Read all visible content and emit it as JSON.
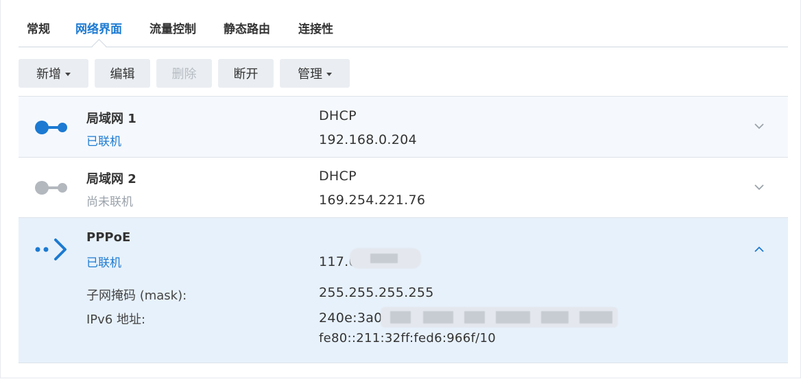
{
  "tabs": [
    {
      "label": "常规",
      "active": false
    },
    {
      "label": "网络界面",
      "active": true
    },
    {
      "label": "流量控制",
      "active": false
    },
    {
      "label": "静态路由",
      "active": false
    },
    {
      "label": "连接性",
      "active": false
    }
  ],
  "toolbar": {
    "add_label": "新增",
    "edit_label": "编辑",
    "delete_label": "删除",
    "disconnect_label": "断开",
    "manage_label": "管理"
  },
  "interfaces": [
    {
      "name": "局域网 1",
      "status": "已联机",
      "mode": "DHCP",
      "ip": "192.168.0.204",
      "icon": "ethernet-connected-icon",
      "expanded": false
    },
    {
      "name": "局域网 2",
      "status": "尚未联机",
      "mode": "DHCP",
      "ip": "169.254.221.76",
      "icon": "ethernet-disconnected-icon",
      "expanded": false
    },
    {
      "name": "PPPoE",
      "status": "已联机",
      "ip": "117.6",
      "icon": "pppoe-icon",
      "expanded": true,
      "details": {
        "mask_label": "子网掩码 (mask):",
        "mask_value": "255.255.255.255",
        "ipv6_label": "IPv6 地址:",
        "ipv6_value1": "240e:3a0",
        "ipv6_value2": "fe80::211:32ff:fed6:966f/10"
      }
    }
  ],
  "colors": {
    "accent": "#1c7ad2",
    "selected_bg": "#e7f1fb",
    "hover_bg": "#f5f9fd",
    "inactive": "#9aa2aa"
  }
}
